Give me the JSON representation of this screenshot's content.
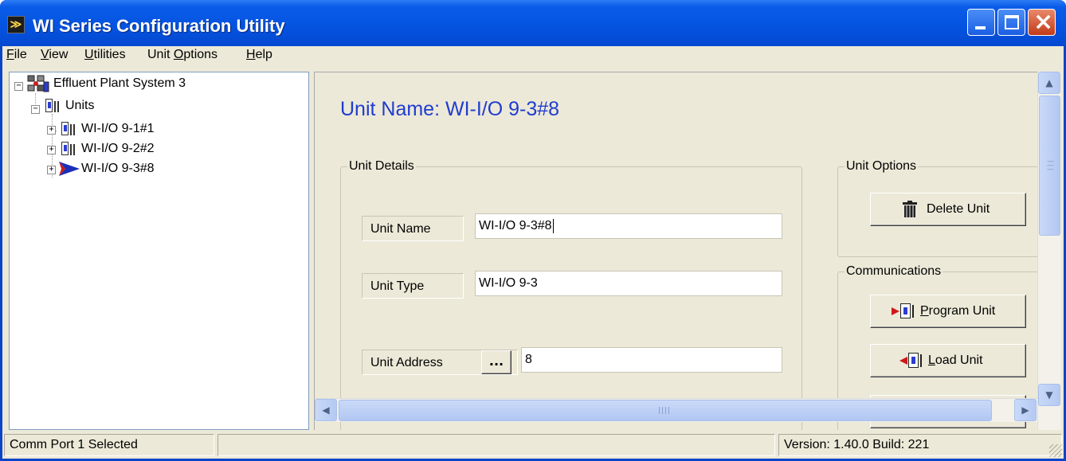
{
  "window": {
    "title": "WI Series Configuration Utility",
    "icon_glyph": "≫"
  },
  "menu": {
    "items": [
      "File",
      "View",
      "Utilities",
      "Unit Options",
      "Help"
    ],
    "mnemonics": [
      "F",
      "V",
      "U",
      "O",
      "H"
    ]
  },
  "tree": {
    "root": "Effluent Plant System 3",
    "units_label": "Units",
    "units": [
      "WI-I/O 9-1#1",
      "WI-I/O 9-2#2",
      "WI-I/O 9-3#8"
    ],
    "selected_index": 2
  },
  "main": {
    "unit_name_heading": "Unit Name: WI-I/O 9-3#8",
    "unit_details": {
      "group_label": "Unit Details",
      "unit_name_label": "Unit Name",
      "unit_name_value": "WI-I/O 9-3#8",
      "unit_type_label": "Unit Type",
      "unit_type_value": "WI-I/O 9-3",
      "unit_address_label": "Unit Address",
      "unit_address_button": "...",
      "unit_address_value": "8"
    },
    "unit_options": {
      "group_label": "Unit Options",
      "delete_button": "Delete Unit"
    },
    "communications": {
      "group_label": "Communications",
      "program_button": "Program Unit",
      "program_mnemonic": "P",
      "load_button": "Load Unit",
      "load_mnemonic": "L"
    }
  },
  "status": {
    "left": "Comm Port 1 Selected",
    "middle": "",
    "right": "Version: 1.40.0 Build: 221"
  },
  "colors": {
    "titlebar": "#0453e0",
    "accent_heading": "#1f3cd0",
    "face": "#ece9d8"
  }
}
